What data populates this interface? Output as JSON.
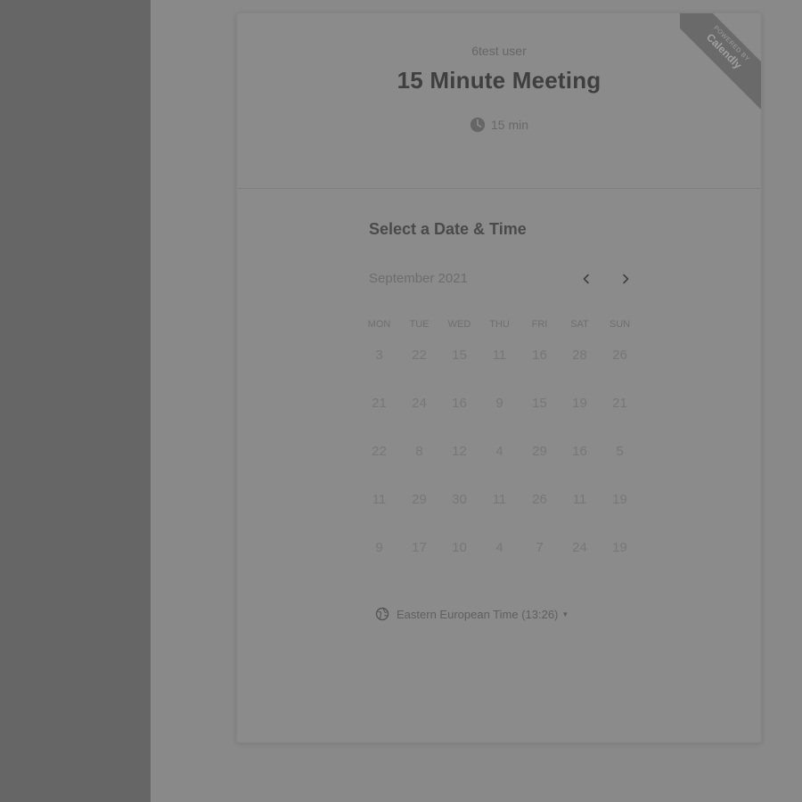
{
  "header": {
    "host_name": "6test user",
    "event_title": "15 Minute Meeting",
    "duration": "15 min",
    "duration_icon": "clock-icon"
  },
  "badge": {
    "small_text": "POWERED BY",
    "brand": "Calendly"
  },
  "scheduler": {
    "section_title": "Select a Date & Time",
    "month_label": "September 2021",
    "prev_icon": "chevron-left-icon",
    "next_icon": "chevron-right-icon",
    "weekdays": [
      "MON",
      "TUE",
      "WED",
      "THU",
      "FRI",
      "SAT",
      "SUN"
    ],
    "weeks": [
      [
        "3",
        "22",
        "15",
        "11",
        "16",
        "28",
        "26"
      ],
      [
        "21",
        "24",
        "16",
        "9",
        "15",
        "19",
        "21"
      ],
      [
        "22",
        "8",
        "12",
        "4",
        "29",
        "16",
        "5"
      ],
      [
        "11",
        "29",
        "30",
        "11",
        "26",
        "11",
        "19"
      ],
      [
        "9",
        "17",
        "10",
        "4",
        "7",
        "24",
        "19"
      ]
    ],
    "timezone": {
      "label": "Eastern European Time (13:26)",
      "icon": "globe-icon",
      "caret_icon": "caret-down-icon"
    }
  },
  "colors": {
    "overlay_left": "#666666",
    "overlay_right": "#898989",
    "title_text": "#3f3f3f"
  }
}
